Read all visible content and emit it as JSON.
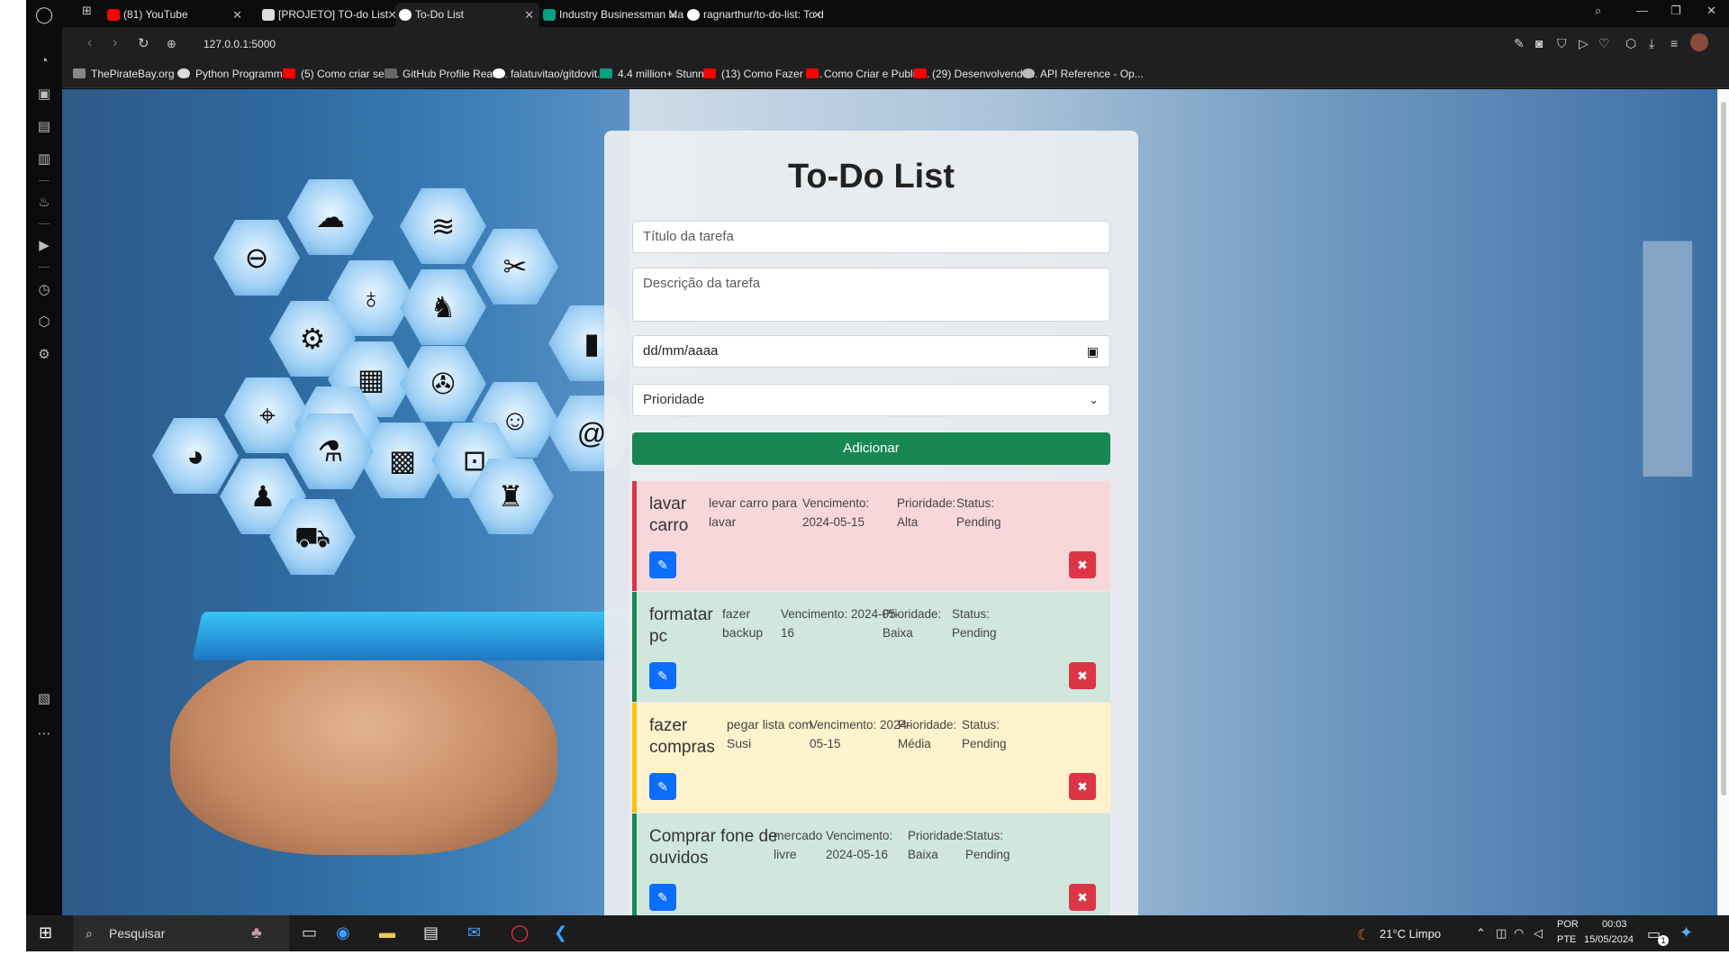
{
  "browser": {
    "tabs": [
      {
        "label": "(81) YouTube",
        "color": "#ff0000"
      },
      {
        "label": "[PROJETO] TO-do List",
        "color": "#dddddd"
      },
      {
        "label": "To-Do List",
        "color": "#ffffff",
        "active": true
      },
      {
        "label": "Industry Businessman Man",
        "color": "#05a081"
      },
      {
        "label": "ragnarthur/to-do-list: To d",
        "color": "#ffffff"
      }
    ],
    "url": "127.0.0.1:5000",
    "bookmarks": [
      {
        "label": "ThePirateBay.org -...",
        "color": "#888888"
      },
      {
        "label": "Python Programmi...",
        "color": "#dddddd"
      },
      {
        "label": "(5) Como criar seu...",
        "color": "#ff0000"
      },
      {
        "label": "GitHub Profile Read...",
        "color": "#666666"
      },
      {
        "label": "falatuvitao/gitdovit...",
        "color": "#ffffff"
      },
      {
        "label": "4.4 million+ Stunni...",
        "color": "#05a081"
      },
      {
        "label": "(13) Como Fazer U...",
        "color": "#ff0000"
      },
      {
        "label": "Como Criar e Public...",
        "color": "#ff0000"
      },
      {
        "label": "(29) Desenvolvendo...",
        "color": "#ff0000"
      },
      {
        "label": "API Reference - Op...",
        "color": "#bbbbbb"
      }
    ]
  },
  "app": {
    "title": "To-Do List",
    "title_placeholder": "Título da tarefa",
    "desc_placeholder": "Descrição da tarefa",
    "date_placeholder": "dd/mm/aaaa",
    "priority_label": "Prioridade",
    "add_label": "Adicionar",
    "tasks": [
      {
        "title": "lavar carro",
        "desc": "levar carro para lavar",
        "due": "Vencimento: 2024-05-15",
        "priority": "Prioridade: Alta",
        "status": "Status: Pending",
        "bg": "#f8d7da",
        "border": "#dc3545"
      },
      {
        "title": "formatar pc",
        "desc": "fazer backup",
        "due": "Vencimento: 2024-05-16",
        "priority": "Prioridade: Baixa",
        "status": "Status: Pending",
        "bg": "#d1e7dd",
        "border": "#198754"
      },
      {
        "title": "fazer compras",
        "desc": "pegar lista com Susi",
        "due": "Vencimento: 2024-05-15",
        "priority": "Prioridade: Média",
        "status": "Status: Pending",
        "bg": "#fff3cd",
        "border": "#ffc107"
      },
      {
        "title": "Comprar fone de ouvidos",
        "desc": "mercado livre",
        "due": "Vencimento: 2024-05-16",
        "priority": "Prioridade: Baixa",
        "status": "Status: Pending",
        "bg": "#d1e7dd",
        "border": "#198754"
      }
    ]
  },
  "taskbar": {
    "search": "Pesquisar",
    "weather": "21°C  Limpo",
    "lang1": "POR",
    "lang2": "PTE",
    "time": "00:03",
    "date": "15/05/2024",
    "notif": "1"
  }
}
